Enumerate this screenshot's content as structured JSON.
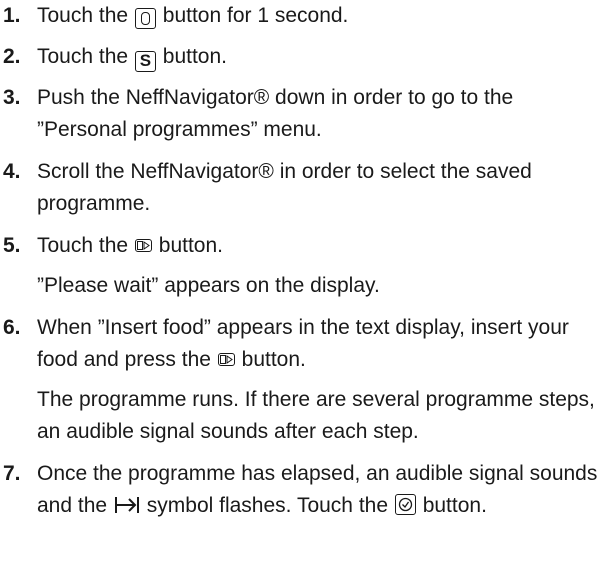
{
  "steps": [
    {
      "number": "1.",
      "text_before": "Touch the",
      "text_after": "button for 1 second.",
      "icon": "on-off-icon"
    },
    {
      "number": "2.",
      "text_before": "Touch the",
      "text_after": "button.",
      "icon": "s-button-icon",
      "icon_text": "S"
    },
    {
      "number": "3.",
      "text": "Push the NeffNavigator® down in order to go to the ”Personal programmes” menu."
    },
    {
      "number": "4.",
      "text": "Scroll the NeffNavigator® in order to select the saved programme."
    },
    {
      "number": "5.",
      "text_before": "Touch the",
      "text_after": "button.",
      "icon": "start-icon",
      "result": "”Please wait” appears on the display."
    },
    {
      "number": "6.",
      "text_before": "When ”Insert food” appears in the text display, insert your food and press the",
      "text_after": "button.",
      "icon": "start-icon",
      "result": "The programme runs. If there are several programme steps, an audible signal sounds after each step."
    },
    {
      "number": "7.",
      "text_before": "Once the programme has elapsed, an audible signal sounds and the",
      "text_middle": "symbol flashes. Touch the",
      "text_after": "button.",
      "icon_middle": "end-time-icon",
      "icon": "clock-icon"
    }
  ]
}
